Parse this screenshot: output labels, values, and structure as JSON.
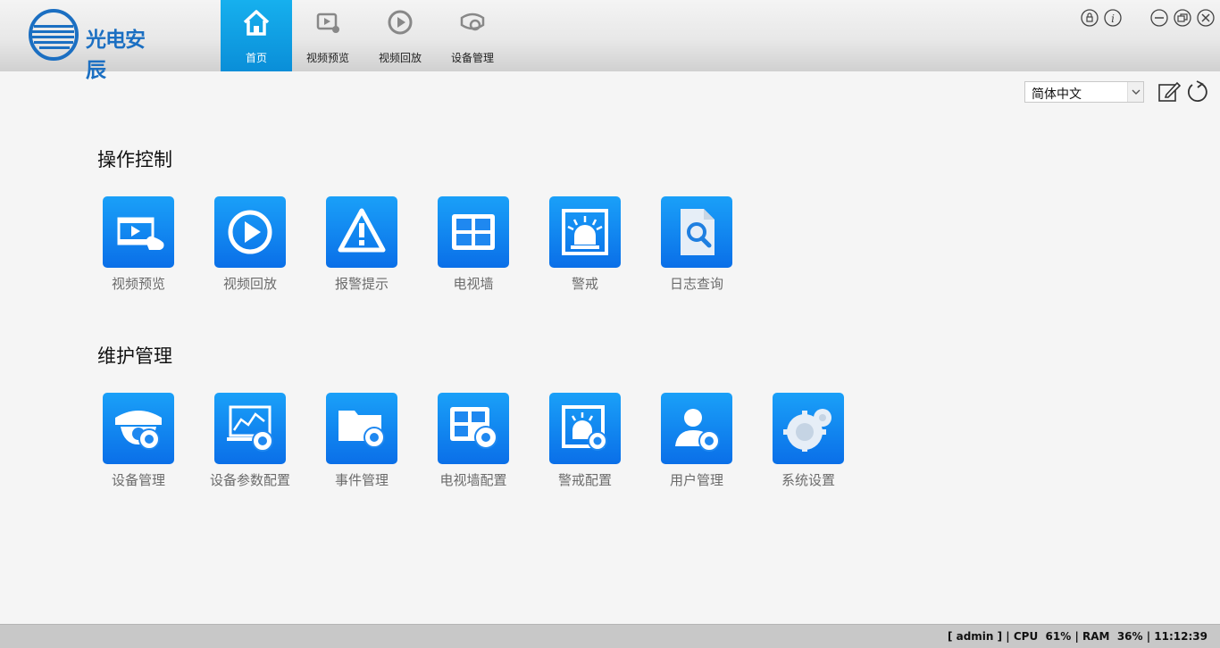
{
  "app": {
    "logo_text": "光电安辰"
  },
  "nav": {
    "tabs": [
      {
        "label": "首页",
        "icon": "home-icon",
        "active": true
      },
      {
        "label": "视频预览",
        "icon": "video-preview-icon"
      },
      {
        "label": "视频回放",
        "icon": "playback-icon"
      },
      {
        "label": "设备管理",
        "icon": "device-management-icon"
      }
    ]
  },
  "window_controls": {
    "lock": "lock-icon",
    "info": "info-icon",
    "minimize": "minimize-icon",
    "restore": "restore-icon",
    "close": "close-icon"
  },
  "toolbar": {
    "language": {
      "selected": "简体中文"
    },
    "edit": "edit-icon",
    "refresh": "refresh-icon"
  },
  "sections": {
    "operation": {
      "title": "操作控制",
      "items": [
        {
          "label": "视频预览",
          "icon": "video-preview-icon"
        },
        {
          "label": "视频回放",
          "icon": "playback-icon"
        },
        {
          "label": "报警提示",
          "icon": "alarm-warning-icon"
        },
        {
          "label": "电视墙",
          "icon": "tv-wall-icon"
        },
        {
          "label": "警戒",
          "icon": "alert-light-icon"
        },
        {
          "label": "日志查询",
          "icon": "log-search-icon"
        }
      ]
    },
    "maintenance": {
      "title": "维护管理",
      "items": [
        {
          "label": "设备管理",
          "icon": "camera-gear-icon"
        },
        {
          "label": "设备参数配置",
          "icon": "device-params-icon"
        },
        {
          "label": "事件管理",
          "icon": "event-folder-icon"
        },
        {
          "label": "电视墙配置",
          "icon": "tv-wall-config-icon"
        },
        {
          "label": "警戒配置",
          "icon": "alert-config-icon"
        },
        {
          "label": "用户管理",
          "icon": "user-management-icon"
        },
        {
          "label": "系统设置",
          "icon": "system-settings-icon"
        }
      ]
    }
  },
  "status": {
    "text": "[ admin ] | CPU  61% | RAM  36% | 11:12:39"
  }
}
